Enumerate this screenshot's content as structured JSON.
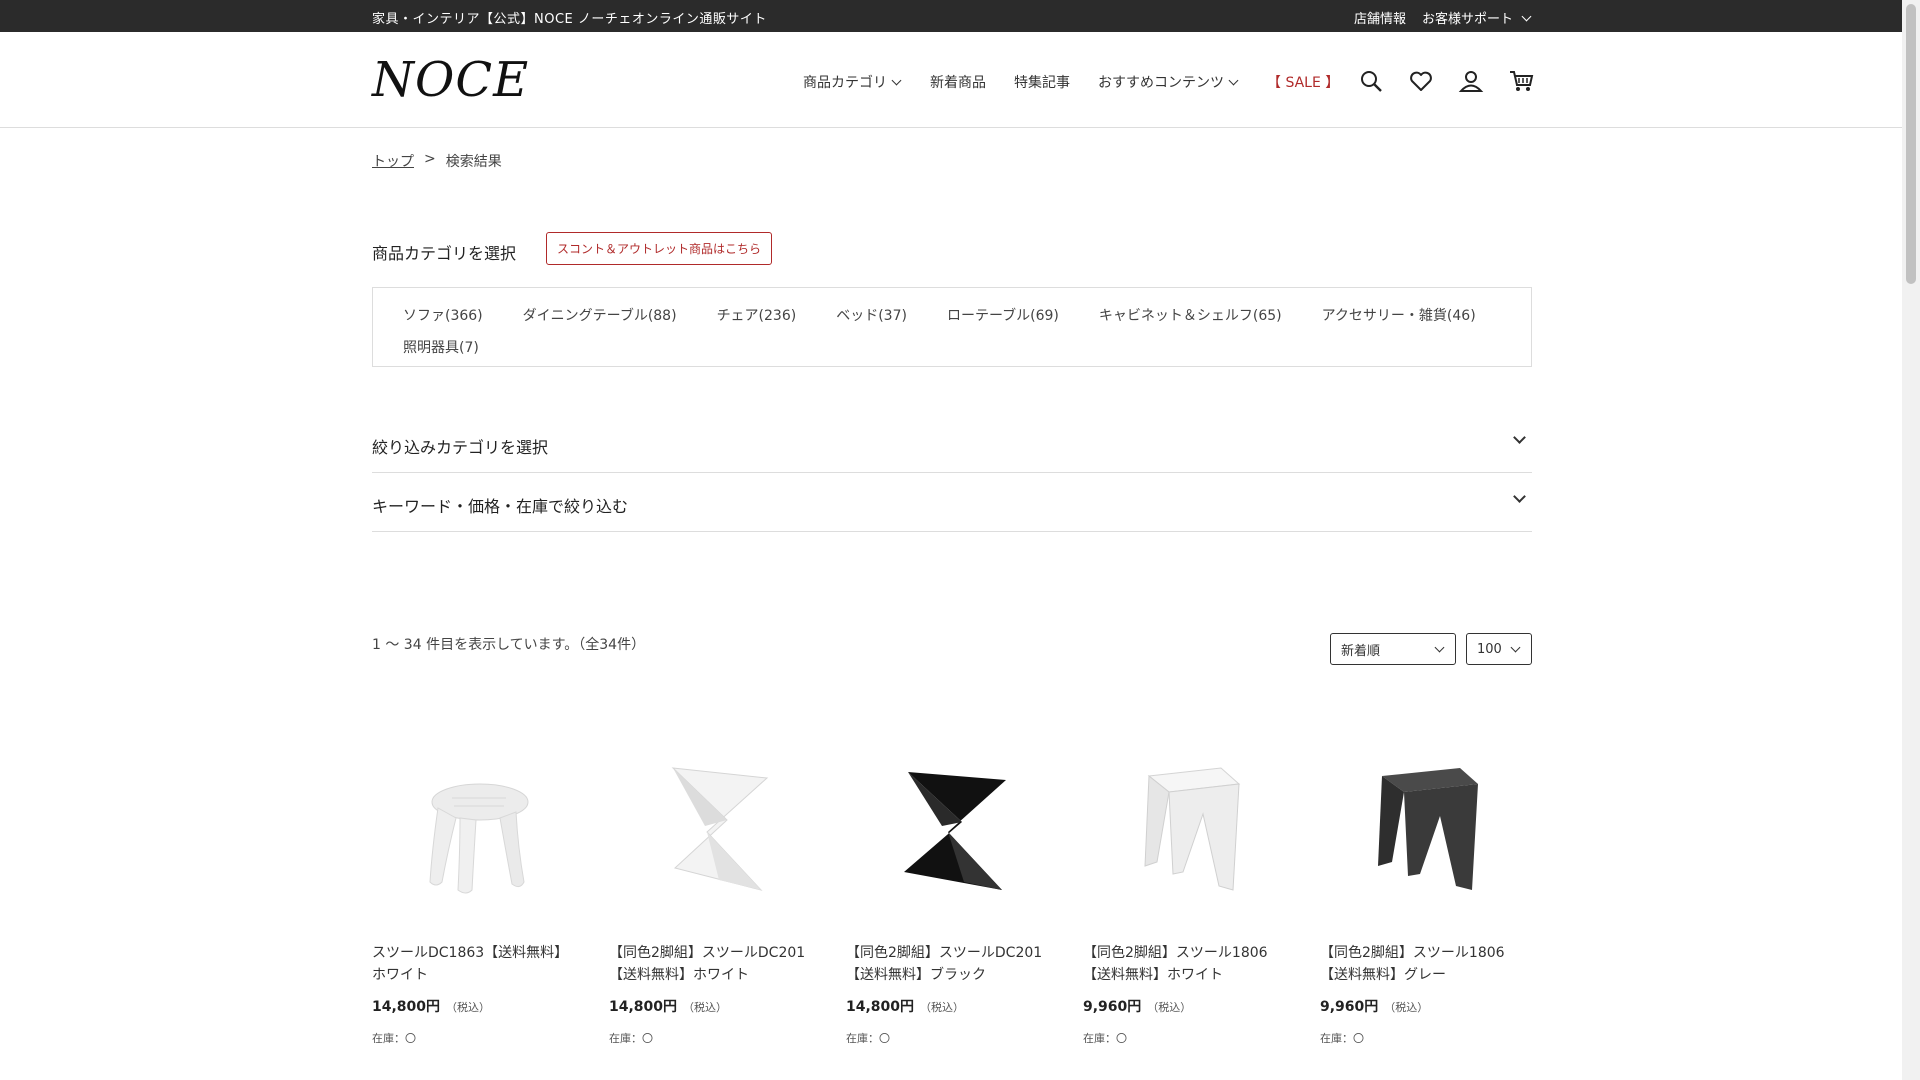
{
  "topbar": {
    "site_title": "家具・インテリア【公式】NOCE ノーチェオンライン通販サイト",
    "store_info": "店舗情報",
    "support": "お客様サポート"
  },
  "header": {
    "logo": "NOCE",
    "nav": {
      "category": "商品カテゴリ",
      "new": "新着商品",
      "feature": "特集記事",
      "recommend": "おすすめコンテンツ",
      "sale": "【 SALE 】"
    },
    "icons": [
      "search-icon",
      "heart-icon",
      "user-icon",
      "cart-icon"
    ]
  },
  "breadcrumb": {
    "top": "トップ",
    "separator": ">",
    "current": "検索結果"
  },
  "category_select": {
    "title": "商品カテゴリを選択",
    "outlet_button": "スコント＆アウトレット商品はこちら",
    "categories": [
      "ソファ(366)",
      "ダイニングテーブル(88)",
      "チェア(236)",
      "ベッド(37)",
      "ローテーブル(69)",
      "キャビネット＆シェルフ(65)",
      "アクセサリー・雑貨(46)",
      "照明器具(7)"
    ]
  },
  "filters": {
    "refine_category": "絞り込みカテゴリを選択",
    "keyword_price": "キーワード・価格・在庫で絞り込む"
  },
  "results": {
    "count_text": "1 〜 34 件目を表示しています。（全34件）",
    "sort_value": "新着順",
    "per_page_value": "100"
  },
  "products": [
    {
      "name": "スツールDC1863【送料無料】ホワイト",
      "price": "14,800円",
      "tax": "（税込）",
      "stock": "在庫：〇"
    },
    {
      "name": "【同色2脚組】スツールDC201【送料無料】ホワイト",
      "price": "14,800円",
      "tax": "（税込）",
      "stock": "在庫：〇"
    },
    {
      "name": "【同色2脚組】スツールDC201【送料無料】ブラック",
      "price": "14,800円",
      "tax": "（税込）",
      "stock": "在庫：〇"
    },
    {
      "name": "【同色2脚組】スツール1806【送料無料】ホワイト",
      "price": "9,960円",
      "tax": "（税込）",
      "stock": "在庫：〇"
    },
    {
      "name": "【同色2脚組】スツール1806【送料無料】グレー",
      "price": "9,960円",
      "tax": "（税込）",
      "stock": "在庫：〇"
    }
  ],
  "colors": {
    "topbar_bg": "#2b2b2b",
    "sale_red": "#b02a2a",
    "border": "#dddddd"
  }
}
